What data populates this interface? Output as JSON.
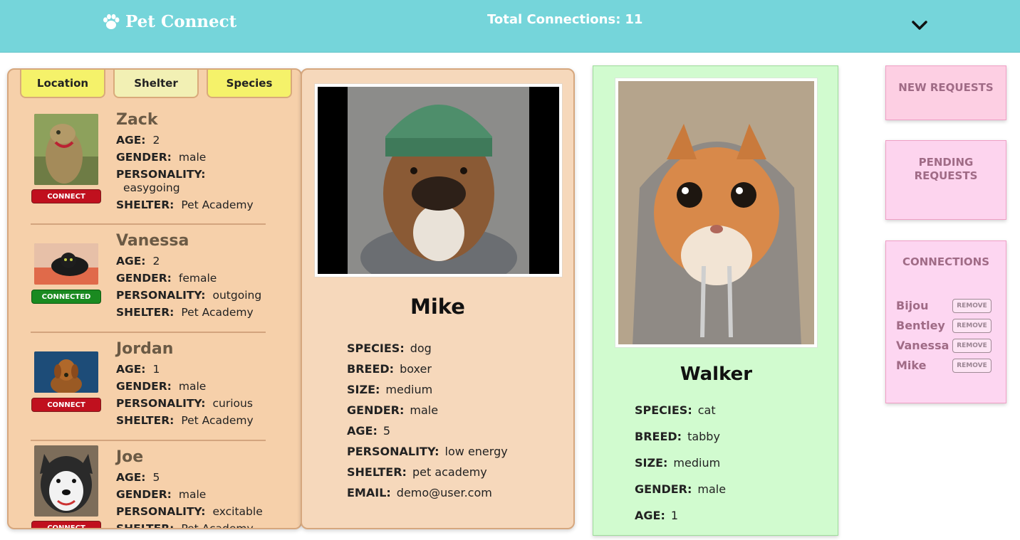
{
  "header": {
    "app_name": "Pet Connect",
    "total_label": "Total Connections:",
    "total_value": "11",
    "logo_icon": "paw-icon",
    "menu_icon": "chevron-down-icon"
  },
  "filters": [
    {
      "label": "Location",
      "active": true
    },
    {
      "label": "Shelter",
      "active": false
    },
    {
      "label": "Species",
      "active": true
    }
  ],
  "pets": [
    {
      "name": "Zack",
      "age_label": "AGE:",
      "age": "2",
      "gender_label": "GENDER:",
      "gender": "male",
      "personality_label": "PERSONALITY:",
      "personality": "easygoing",
      "shelter_label": "SHELTER:",
      "shelter": "Pet Academy",
      "button": "CONNECT"
    },
    {
      "name": "Vanessa",
      "age_label": "AGE:",
      "age": "2",
      "gender_label": "GENDER:",
      "gender": "female",
      "personality_label": "PERSONALITY:",
      "personality": "outgoing",
      "shelter_label": "SHELTER:",
      "shelter": "Pet Academy",
      "button": "CONNECTED"
    },
    {
      "name": "Jordan",
      "age_label": "AGE:",
      "age": "1",
      "gender_label": "GENDER:",
      "gender": "male",
      "personality_label": "PERSONALITY:",
      "personality": "curious",
      "shelter_label": "SHELTER:",
      "shelter": "Pet Academy",
      "button": "CONNECT"
    },
    {
      "name": "Joe",
      "age_label": "AGE:",
      "age": "5",
      "gender_label": "GENDER:",
      "gender": "male",
      "personality_label": "PERSONALITY:",
      "personality": "excitable",
      "shelter_label": "SHELTER:",
      "shelter": "Pet Academy",
      "button": "CONNECT"
    }
  ],
  "main_card": {
    "name": "Mike",
    "fields": [
      {
        "label": "SPECIES:",
        "value": "dog"
      },
      {
        "label": "BREED:",
        "value": "boxer"
      },
      {
        "label": "SIZE:",
        "value": "medium"
      },
      {
        "label": "GENDER:",
        "value": "male"
      },
      {
        "label": "AGE:",
        "value": "5"
      },
      {
        "label": "PERSONALITY:",
        "value": "low energy"
      },
      {
        "label": "SHELTER:",
        "value": "pet academy"
      },
      {
        "label": "EMAIL:",
        "value": "demo@user.com"
      }
    ]
  },
  "own_card": {
    "name": "Walker",
    "fields": [
      {
        "label": "SPECIES:",
        "value": "cat"
      },
      {
        "label": "BREED:",
        "value": "tabby"
      },
      {
        "label": "SIZE:",
        "value": "medium"
      },
      {
        "label": "GENDER:",
        "value": "male"
      },
      {
        "label": "AGE:",
        "value": "1"
      }
    ]
  },
  "side": {
    "new_requests": "NEW REQUESTS",
    "pending_1": "PENDING",
    "pending_2": "REQUESTS",
    "connections_title": "CONNECTIONS",
    "remove_label": "REMOVE",
    "connections": [
      "Bijou",
      "Bentley",
      "Vanessa",
      "Mike"
    ]
  },
  "colors": {
    "header": "#75d5da",
    "panel": "#f6d0aa",
    "own_card": "#d1fbcf",
    "side_box": "#fdd6e8",
    "connect": "#c0101e",
    "connected": "#1a8a20"
  }
}
